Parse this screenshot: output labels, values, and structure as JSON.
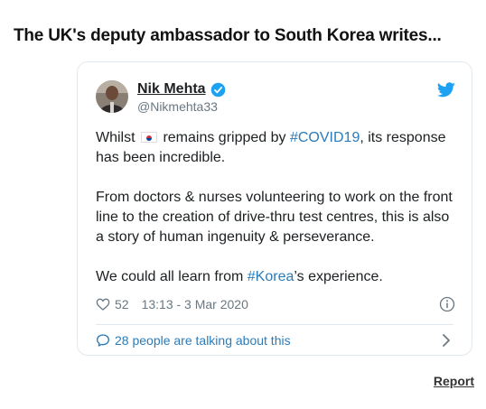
{
  "headline": "The UK's deputy ambassador to South Korea writes...",
  "tweet": {
    "author_name": "Nik Mehta",
    "handle": "@Nikmehta33",
    "verified": true,
    "paragraphs": [
      [
        {
          "type": "text",
          "value": "Whilst "
        },
        {
          "type": "flag",
          "value": "south-korea-flag"
        },
        {
          "type": "text",
          "value": " remains gripped by "
        },
        {
          "type": "hashtag",
          "value": "#COVID19"
        },
        {
          "type": "text",
          "value": ", its response has been incredible."
        }
      ],
      [
        {
          "type": "text",
          "value": "From doctors & nurses volunteering to work on the front line to the creation of drive-thru test centres, this is also a story of human ingenuity & perseverance."
        }
      ],
      [
        {
          "type": "text",
          "value": "We could all learn from "
        },
        {
          "type": "hashtag",
          "value": "#Korea"
        },
        {
          "type": "text",
          "value": "’s experience."
        }
      ]
    ],
    "likes": "52",
    "timestamp": "13:13 - 3 Mar 2020",
    "talking_text": "28 people are talking about this"
  },
  "report_label": "Report",
  "icons": {
    "verified": "verified-badge-icon",
    "bird": "twitter-bird-icon",
    "heart": "heart-icon",
    "info": "info-icon",
    "bubble": "speech-bubble-icon",
    "chevron": "chevron-right-icon"
  },
  "colors": {
    "link_blue": "#2b7bb9",
    "twitter_blue": "#1da1f2",
    "muted": "#697882",
    "border": "#e1e8ed",
    "text": "#1c2022"
  }
}
